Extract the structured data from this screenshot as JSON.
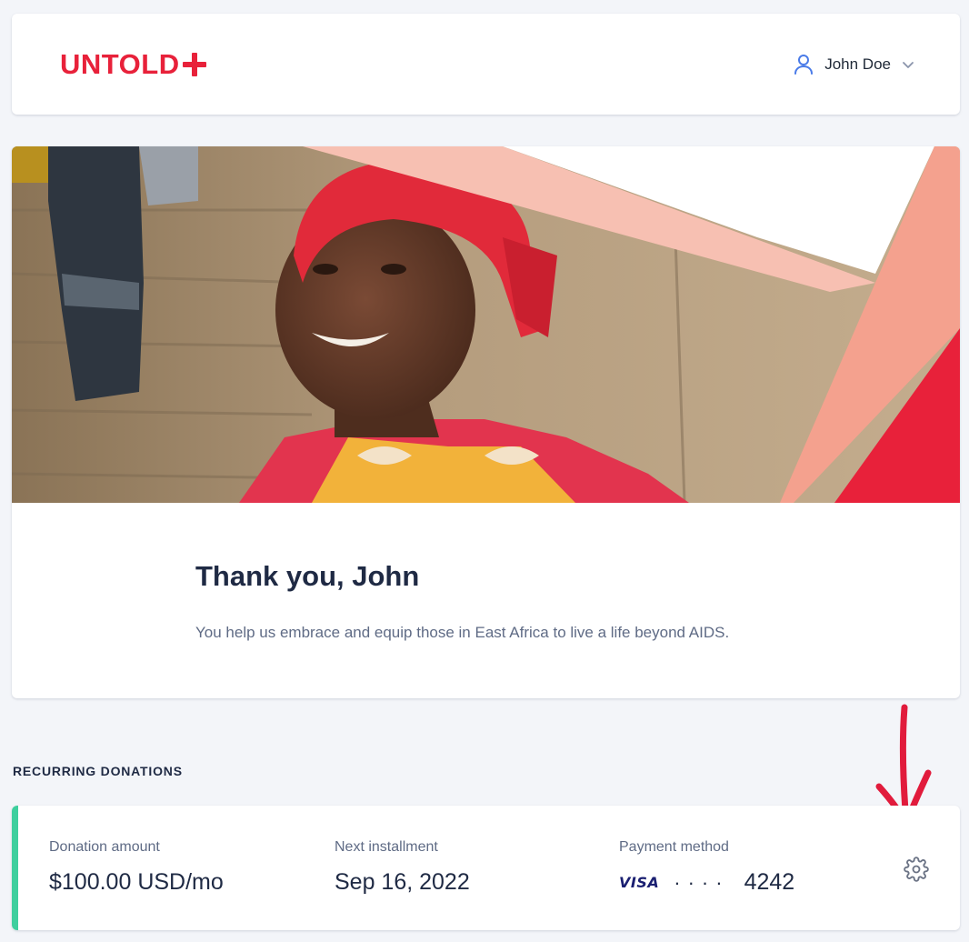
{
  "header": {
    "logo_text": "UNTOLD",
    "user_name": "John Doe"
  },
  "hero": {
    "title": "Thank you, John",
    "subtitle": "You help us embrace and equip those in East Africa to live a life beyond AIDS."
  },
  "recurring": {
    "section_title": "RECURRING DONATIONS",
    "amount_label": "Donation amount",
    "amount_value": "$100.00 USD/mo",
    "next_label": "Next installment",
    "next_value": "Sep 16, 2022",
    "payment_label": "Payment method",
    "card_brand": "VISA",
    "card_mask": "····",
    "card_last4": "4242"
  },
  "colors": {
    "brand_red": "#e8213a",
    "accent_green": "#3ecf9e",
    "text_dark": "#1f2a44"
  }
}
